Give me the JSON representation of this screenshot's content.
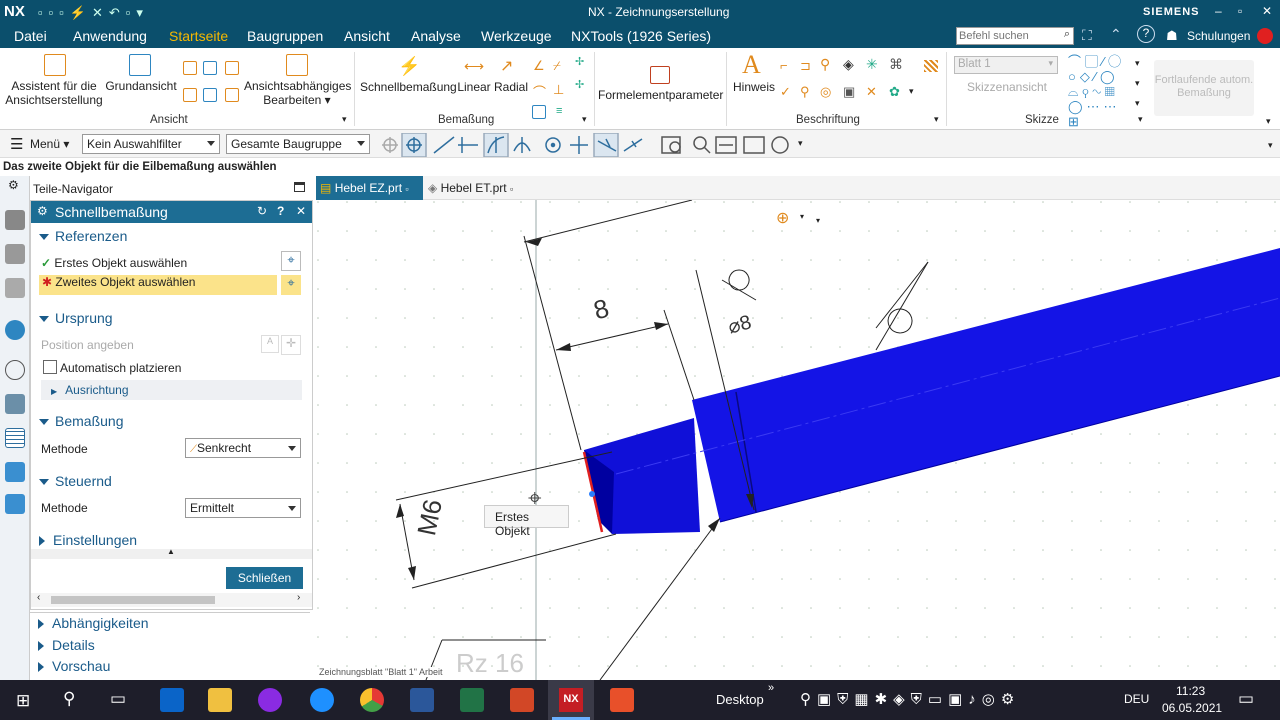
{
  "app": {
    "logo": "NX",
    "title": "NX - Zeichnungserstellung",
    "brand": "SIEMENS",
    "search_placeholder": "Befehl suchen",
    "user": "Schulungen"
  },
  "menu": [
    "Datei",
    "Anwendung",
    "Startseite",
    "Baugruppen",
    "Ansicht",
    "Analyse",
    "Werkzeuge",
    "NXTools (1926 Series)"
  ],
  "ribbon": {
    "assist": "Assistent für die Ansichtserstellung",
    "base_view": "Grundansicht",
    "dep_edit": "Ansichtsabhängiges Bearbeiten",
    "group_view": "Ansicht",
    "quick_dim": "Schnellbemaßung",
    "linear": "Linear",
    "radial": "Radial",
    "group_dim": "Bemaßung",
    "feature_param": "Formelementparameter",
    "note": "Hinweis",
    "group_annot": "Beschriftung",
    "sheet": "Blatt 1",
    "sketch_view": "Skizzenansicht",
    "group_sketch": "Skizze",
    "cont_dim": "Fortlaufende autom. Bemaßung"
  },
  "toolbar": {
    "menu": "Menü",
    "filter": "Kein Auswahlfilter",
    "assembly": "Gesamte Baugruppe"
  },
  "status": "Das zweite Objekt für die Eilbemaßung auswählen",
  "navigator": "Teile-Navigator",
  "dialog": {
    "title": "Schnellbemaßung",
    "sec_refs": "Referenzen",
    "first_obj": "Erstes Objekt auswählen",
    "second_obj": "Zweites Objekt auswählen",
    "sec_origin": "Ursprung",
    "position": "Position angeben",
    "auto_place": "Automatisch platzieren",
    "alignment": "Ausrichtung",
    "sec_dim": "Bemaßung",
    "method_label": "Methode",
    "method_dim": "Senkrecht",
    "sec_drive": "Steuernd",
    "method_drive": "Ermittelt",
    "sec_settings": "Einstellungen",
    "close": "Schließen"
  },
  "lower": [
    "Abhängigkeiten",
    "Details",
    "Vorschau"
  ],
  "tabs": [
    "Hebel EZ.prt",
    "Hebel ET.prt"
  ],
  "canvas": {
    "tooltip": "Erstes Objekt",
    "sheet_label": "Zeichnungsblatt \"Blatt 1\" Arbeit",
    "dim_m6": "M6",
    "dim_8": "8",
    "dim_d8": "⌀8",
    "rz": "Rz  16"
  },
  "taskbar": {
    "desktop": "Desktop",
    "lang": "DEU",
    "time": "11:23",
    "date": "06.05.2021"
  },
  "colors": {
    "titlebar": "#0b4f6c",
    "accent_tab": "#f5b800",
    "dialog_head": "#1d6d94",
    "highlight_row": "#fbe38a",
    "part_blue": "#1414e6"
  }
}
